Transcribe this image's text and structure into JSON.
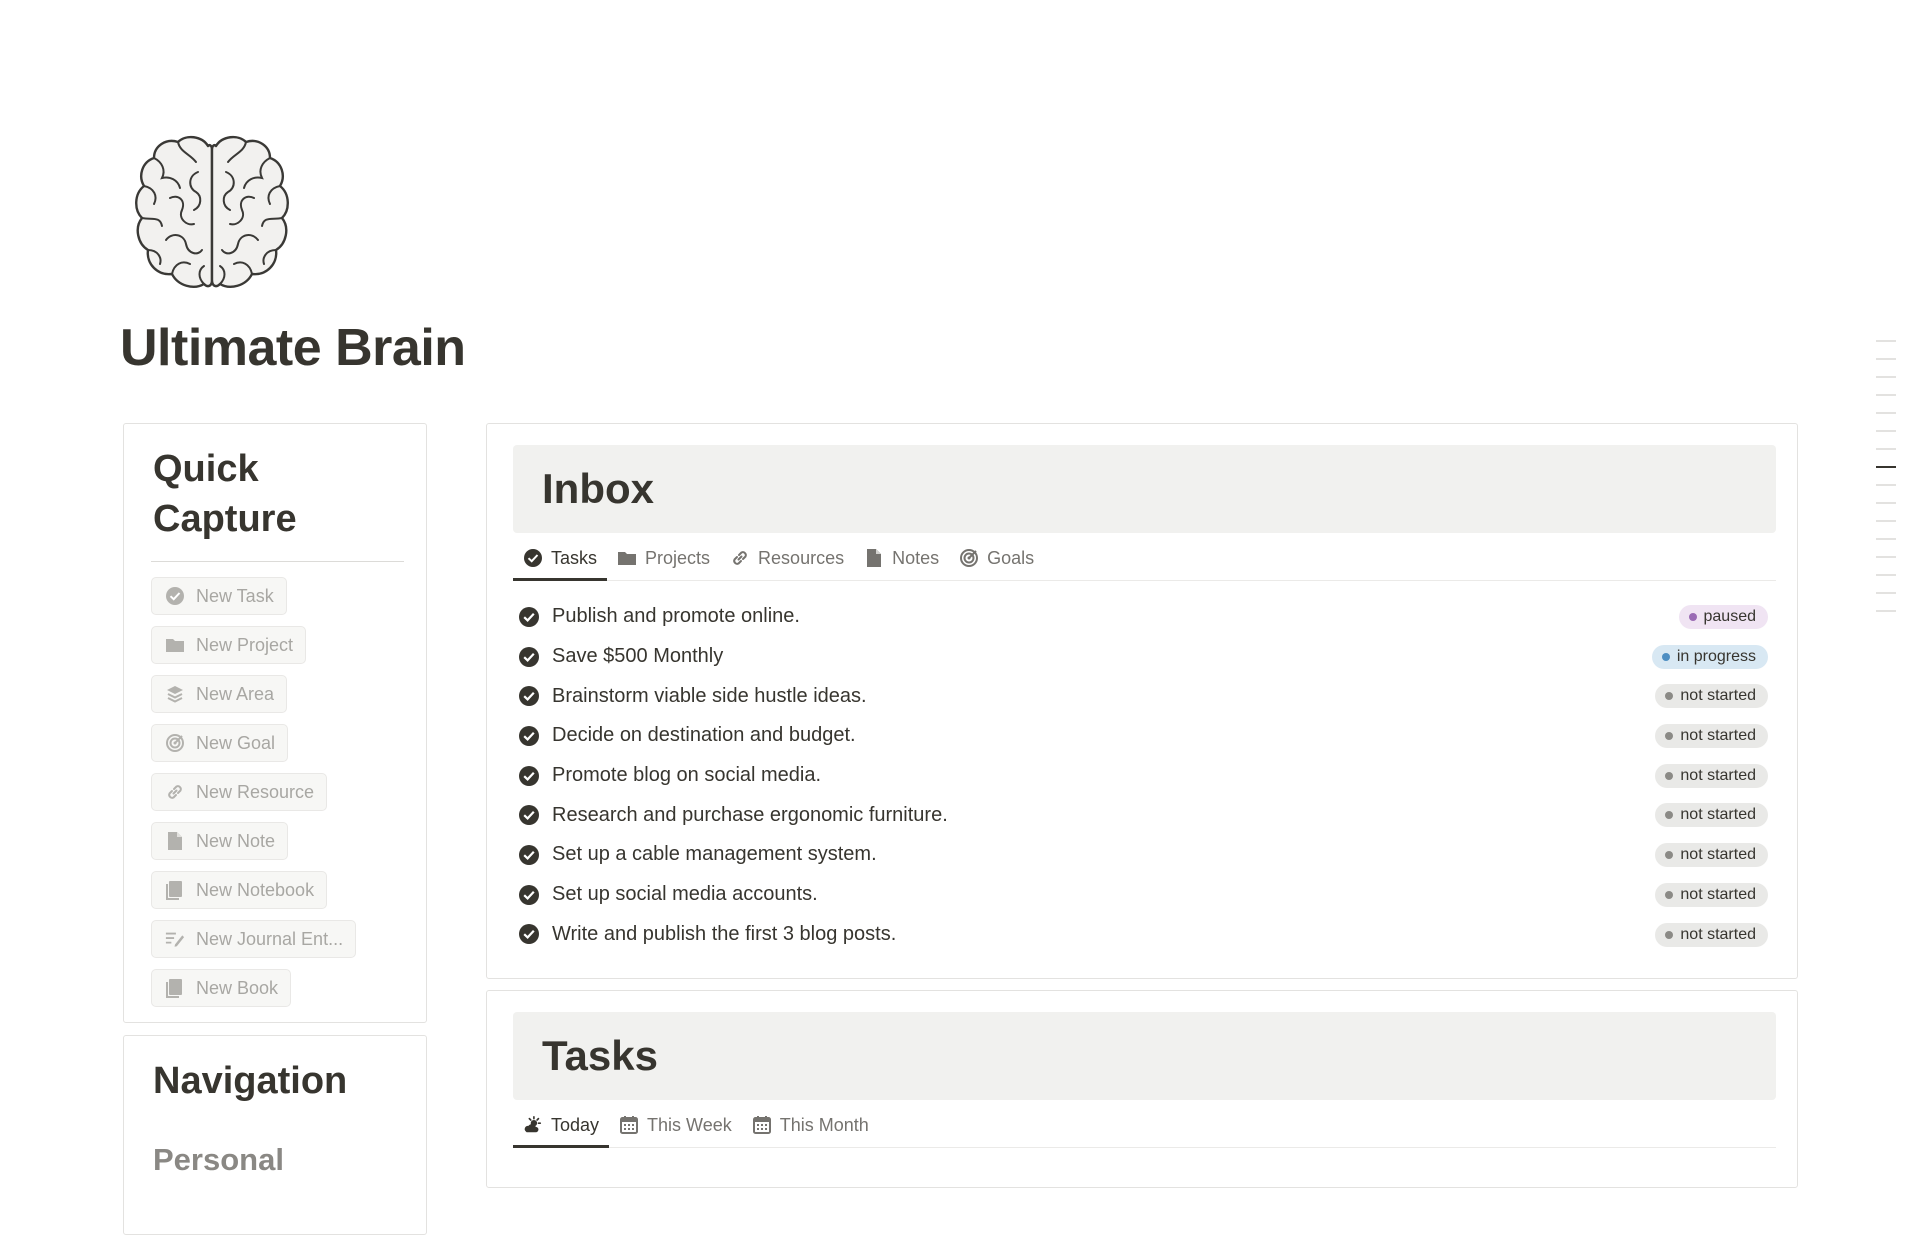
{
  "page": {
    "title": "Ultimate Brain",
    "icon": "brain-icon"
  },
  "quick_capture": {
    "title": "Quick Capture",
    "buttons": [
      {
        "label": "New Task",
        "icon": "check-circle-icon"
      },
      {
        "label": "New Project",
        "icon": "folder-icon"
      },
      {
        "label": "New Area",
        "icon": "layers-icon"
      },
      {
        "label": "New Goal",
        "icon": "target-icon"
      },
      {
        "label": "New Resource",
        "icon": "link-icon"
      },
      {
        "label": "New Note",
        "icon": "document-icon"
      },
      {
        "label": "New Notebook",
        "icon": "notebook-icon"
      },
      {
        "label": "New Journal Ent...",
        "icon": "journal-pen-icon"
      },
      {
        "label": "New Book",
        "icon": "book-icon"
      }
    ]
  },
  "navigation": {
    "title": "Navigation",
    "section": "Personal"
  },
  "inbox": {
    "title": "Inbox",
    "tabs": [
      {
        "label": "Tasks",
        "icon": "check-circle-icon",
        "active": true
      },
      {
        "label": "Projects",
        "icon": "folder-icon"
      },
      {
        "label": "Resources",
        "icon": "link-icon"
      },
      {
        "label": "Notes",
        "icon": "document-icon"
      },
      {
        "label": "Goals",
        "icon": "target-icon"
      }
    ],
    "items": [
      {
        "text": "Publish and promote online.",
        "status": "paused"
      },
      {
        "text": "Save $500 Monthly",
        "status": "in progress"
      },
      {
        "text": "Brainstorm viable side hustle ideas.",
        "status": "not started"
      },
      {
        "text": "Decide on destination and budget.",
        "status": "not started"
      },
      {
        "text": "Promote blog on social media.",
        "status": "not started"
      },
      {
        "text": "Research and purchase ergonomic furniture.",
        "status": "not started"
      },
      {
        "text": "Set up a cable management system.",
        "status": "not started"
      },
      {
        "text": "Set up social media accounts.",
        "status": "not started"
      },
      {
        "text": "Write and publish the first 3 blog posts.",
        "status": "not started"
      }
    ],
    "status_colors": {
      "paused": {
        "bg": "#f0e4f3",
        "dot": "#9a6bb4"
      },
      "in progress": {
        "bg": "#d8e8f3",
        "dot": "#4d8ec2"
      },
      "not started": {
        "bg": "#e9e9e7",
        "dot": "#8b8a86"
      }
    }
  },
  "tasks": {
    "title": "Tasks",
    "tabs": [
      {
        "label": "Today",
        "icon": "sun-cloud-icon",
        "active": true
      },
      {
        "label": "This Week",
        "icon": "calendar-icon"
      },
      {
        "label": "This Month",
        "icon": "calendar-icon"
      }
    ]
  }
}
